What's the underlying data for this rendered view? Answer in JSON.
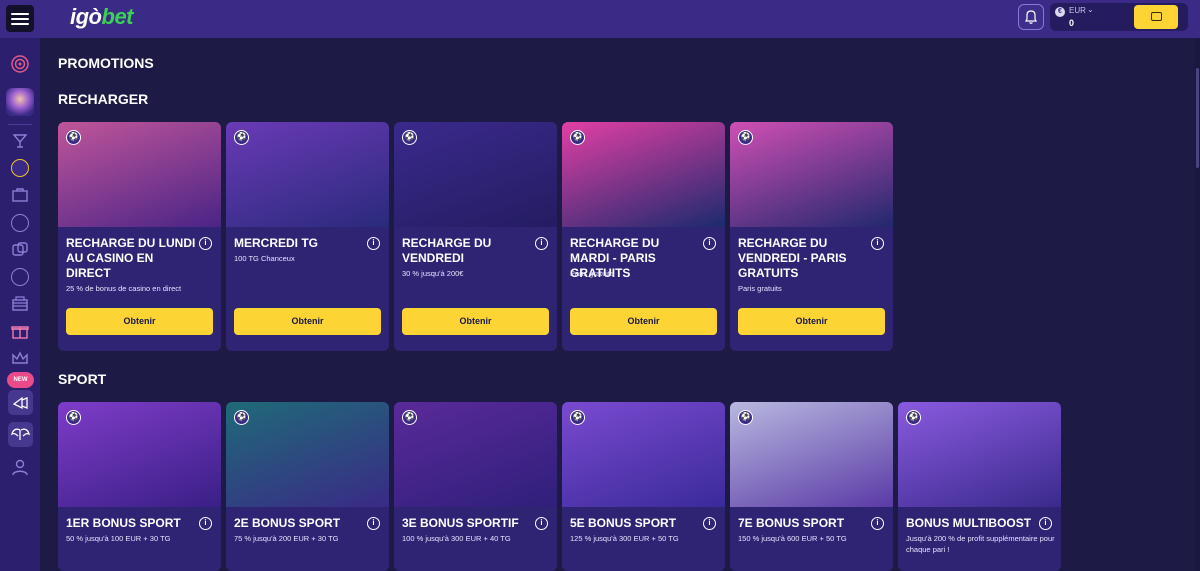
{
  "header": {
    "logo_main": "igò",
    "logo_accent": "bet",
    "currency": "EUR",
    "balance": "0"
  },
  "main": {
    "page_title": "PROMOTIONS",
    "sidebar_badge": "NEW",
    "sections": [
      {
        "title": "RECHARGER",
        "cards": [
          {
            "title": "RECHARGE DU LUNDI AU CASINO EN DIRECT",
            "desc": "25 % de bonus de casino en direct",
            "button": "Obtenir",
            "bg_top": "#c0559a",
            "bg_bottom": "#4a2486"
          },
          {
            "title": "MERCREDI TG",
            "desc": "100 TG Chanceux",
            "button": "Obtenir",
            "bg_top": "#6a3ab6",
            "bg_bottom": "#2a2a7c"
          },
          {
            "title": "RECHARGE DU VENDREDI",
            "desc": "30 % jusqu'à 200€",
            "button": "Obtenir",
            "bg_top": "#3a2a8c",
            "bg_bottom": "#241c62"
          },
          {
            "title": "RECHARGE DU MARDI - PARIS GRATUITS",
            "desc": "Paris gratuits",
            "button": "Obtenir",
            "bg_top": "#e23fa4",
            "bg_bottom": "#1c2a6e"
          },
          {
            "title": "RECHARGE DU VENDREDI - PARIS GRATUITS",
            "desc": "Paris gratuits",
            "button": "Obtenir",
            "bg_top": "#d04fb4",
            "bg_bottom": "#22286e"
          }
        ]
      },
      {
        "title": "SPORT",
        "cards": [
          {
            "title": "1ER BONUS SPORT",
            "desc": "50 % jusqu'à 100 EUR + 30 TG",
            "bg_top": "#7e3cc8",
            "bg_bottom": "#3a1f86"
          },
          {
            "title": "2E BONUS SPORT",
            "desc": "75 % jusqu'à 200 EUR + 30 TG",
            "bg_top": "#1f6a78",
            "bg_bottom": "#3a2a86"
          },
          {
            "title": "3E BONUS SPORTIF",
            "desc": "100 % jusqu'à 300 EUR + 40 TG",
            "bg_top": "#5a2a9a",
            "bg_bottom": "#2f1f7a"
          },
          {
            "title": "5E BONUS SPORT",
            "desc": "125 % jusqu'à 300 EUR + 50 TG",
            "bg_top": "#7a4ad0",
            "bg_bottom": "#3a2a9a"
          },
          {
            "title": "7E BONUS SPORT",
            "desc": "150 % jusqu'à 600 EUR + 50 TG",
            "bg_top": "#b8b8e0",
            "bg_bottom": "#5a3aa6"
          },
          {
            "title": "BONUS MULTIBOOST",
            "desc": "Jusqu'à 200 % de profit supplémentaire pour chaque pari !",
            "bg_top": "#8a5ae0",
            "bg_bottom": "#3a2a8c"
          }
        ]
      }
    ]
  }
}
